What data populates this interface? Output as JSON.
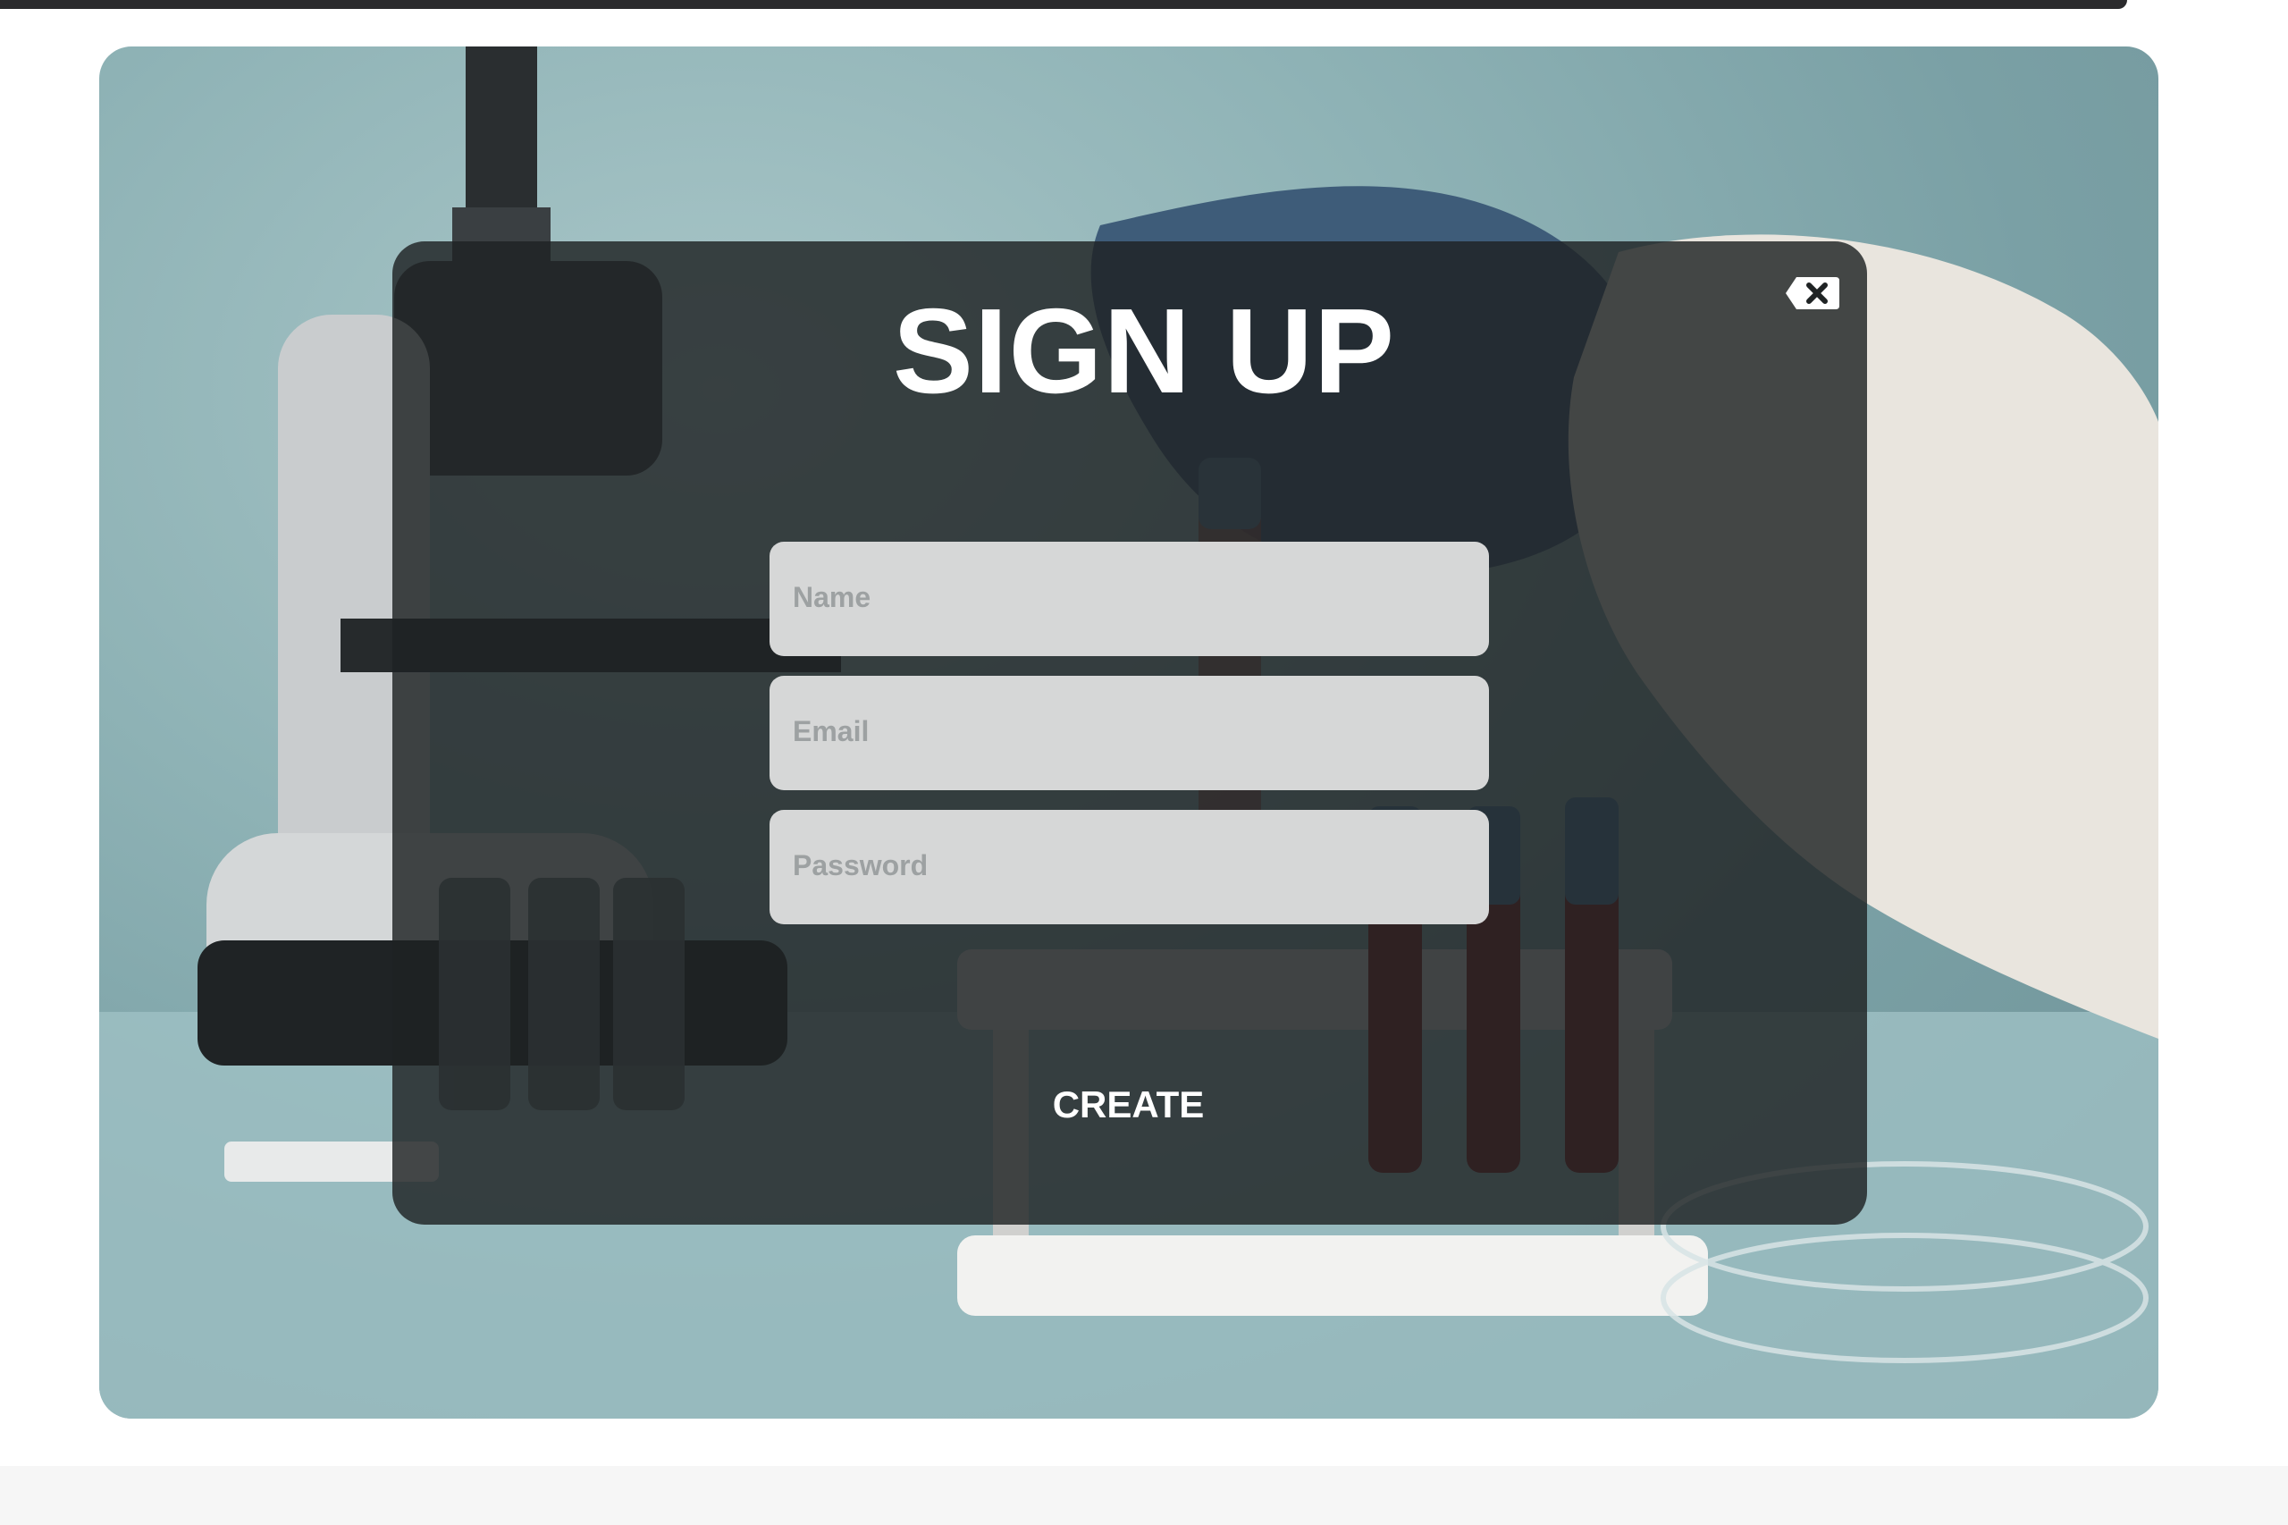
{
  "window": {
    "theme_dark": "#2b2b2d"
  },
  "signup_dialog": {
    "title": "SIGN UP",
    "close_icon": "close-x-icon",
    "fields": {
      "name_placeholder": "Name",
      "email_placeholder": "Email",
      "password_placeholder": "Password"
    },
    "create_label": "CREATE"
  },
  "background_image": {
    "subject": "laboratory-scene",
    "accent": "#8fb3b6"
  }
}
